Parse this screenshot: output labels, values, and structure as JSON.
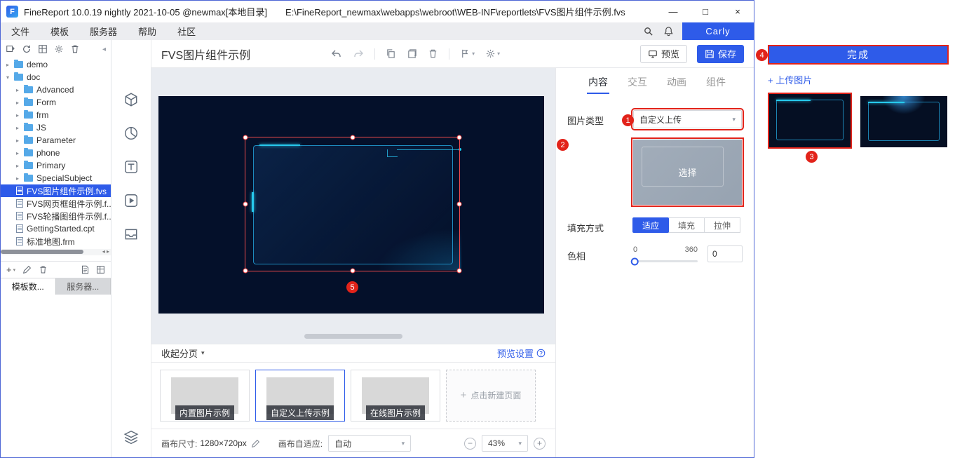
{
  "colors": {
    "accent": "#2e5be9",
    "annotation_red": "#e2231a",
    "selection_red": "#f24b4b",
    "canvas_navy": "#04102a",
    "tech_cyan": "#27c9ec"
  },
  "titlebar": {
    "app_title": "FineReport 10.0.19 nightly 2021-10-05 @newmax[本地目录]",
    "file_path": "E:\\FineReport_newmax\\webapps\\webroot\\WEB-INF\\reportlets\\FVS图片组件示例.fvs",
    "minimize": "—",
    "maximize": "□",
    "close": "×"
  },
  "menubar": {
    "items": [
      "文件",
      "模板",
      "服务器",
      "帮助",
      "社区"
    ],
    "user": "Carly"
  },
  "tree": {
    "items": [
      {
        "label": "demo"
      },
      {
        "label": "doc"
      },
      {
        "label": "Advanced"
      },
      {
        "label": "Form"
      },
      {
        "label": "frm"
      },
      {
        "label": "JS"
      },
      {
        "label": "Parameter"
      },
      {
        "label": "phone"
      },
      {
        "label": "Primary"
      },
      {
        "label": "SpecialSubject"
      },
      {
        "label": "FVS图片组件示例.fvs"
      },
      {
        "label": "FVS网页框组件示例.f..."
      },
      {
        "label": "FVS轮播图组件示例.f..."
      },
      {
        "label": "GettingStarted.cpt"
      },
      {
        "label": "标准地图.frm"
      }
    ],
    "tabs": {
      "templates": "模板数...",
      "server": "服务器..."
    }
  },
  "doc": {
    "title": "FVS图片组件示例",
    "preview_button": "预览",
    "save_button": "保存"
  },
  "canvas": {
    "collapse_pages": "收起分页",
    "preview_settings": "预览设置",
    "pages": [
      {
        "label": "内置图片示例"
      },
      {
        "label": "自定义上传示例"
      },
      {
        "label": "在线图片示例"
      }
    ],
    "new_page": "点击新建页面",
    "size_label": "画布尺寸:",
    "size_value": "1280×720px",
    "fit_label": "画布自适应:",
    "fit_value": "自动",
    "zoom": "43%"
  },
  "props": {
    "tabs": [
      "内容",
      "交互",
      "动画",
      "组件"
    ],
    "image_type_label": "图片类型",
    "image_type_value": "自定义上传",
    "choose_button": "选择",
    "fill_label": "填充方式",
    "fill_options": [
      "适应",
      "填充",
      "拉伸"
    ],
    "hue_label": "色相",
    "hue_min": "0",
    "hue_max": "360",
    "hue_value": "0"
  },
  "upload_panel": {
    "done_button": "完成",
    "upload_link": "+ 上传图片"
  },
  "annotations": {
    "s1": "1",
    "s2": "2",
    "s3": "3",
    "s4": "4",
    "s5": "5"
  }
}
